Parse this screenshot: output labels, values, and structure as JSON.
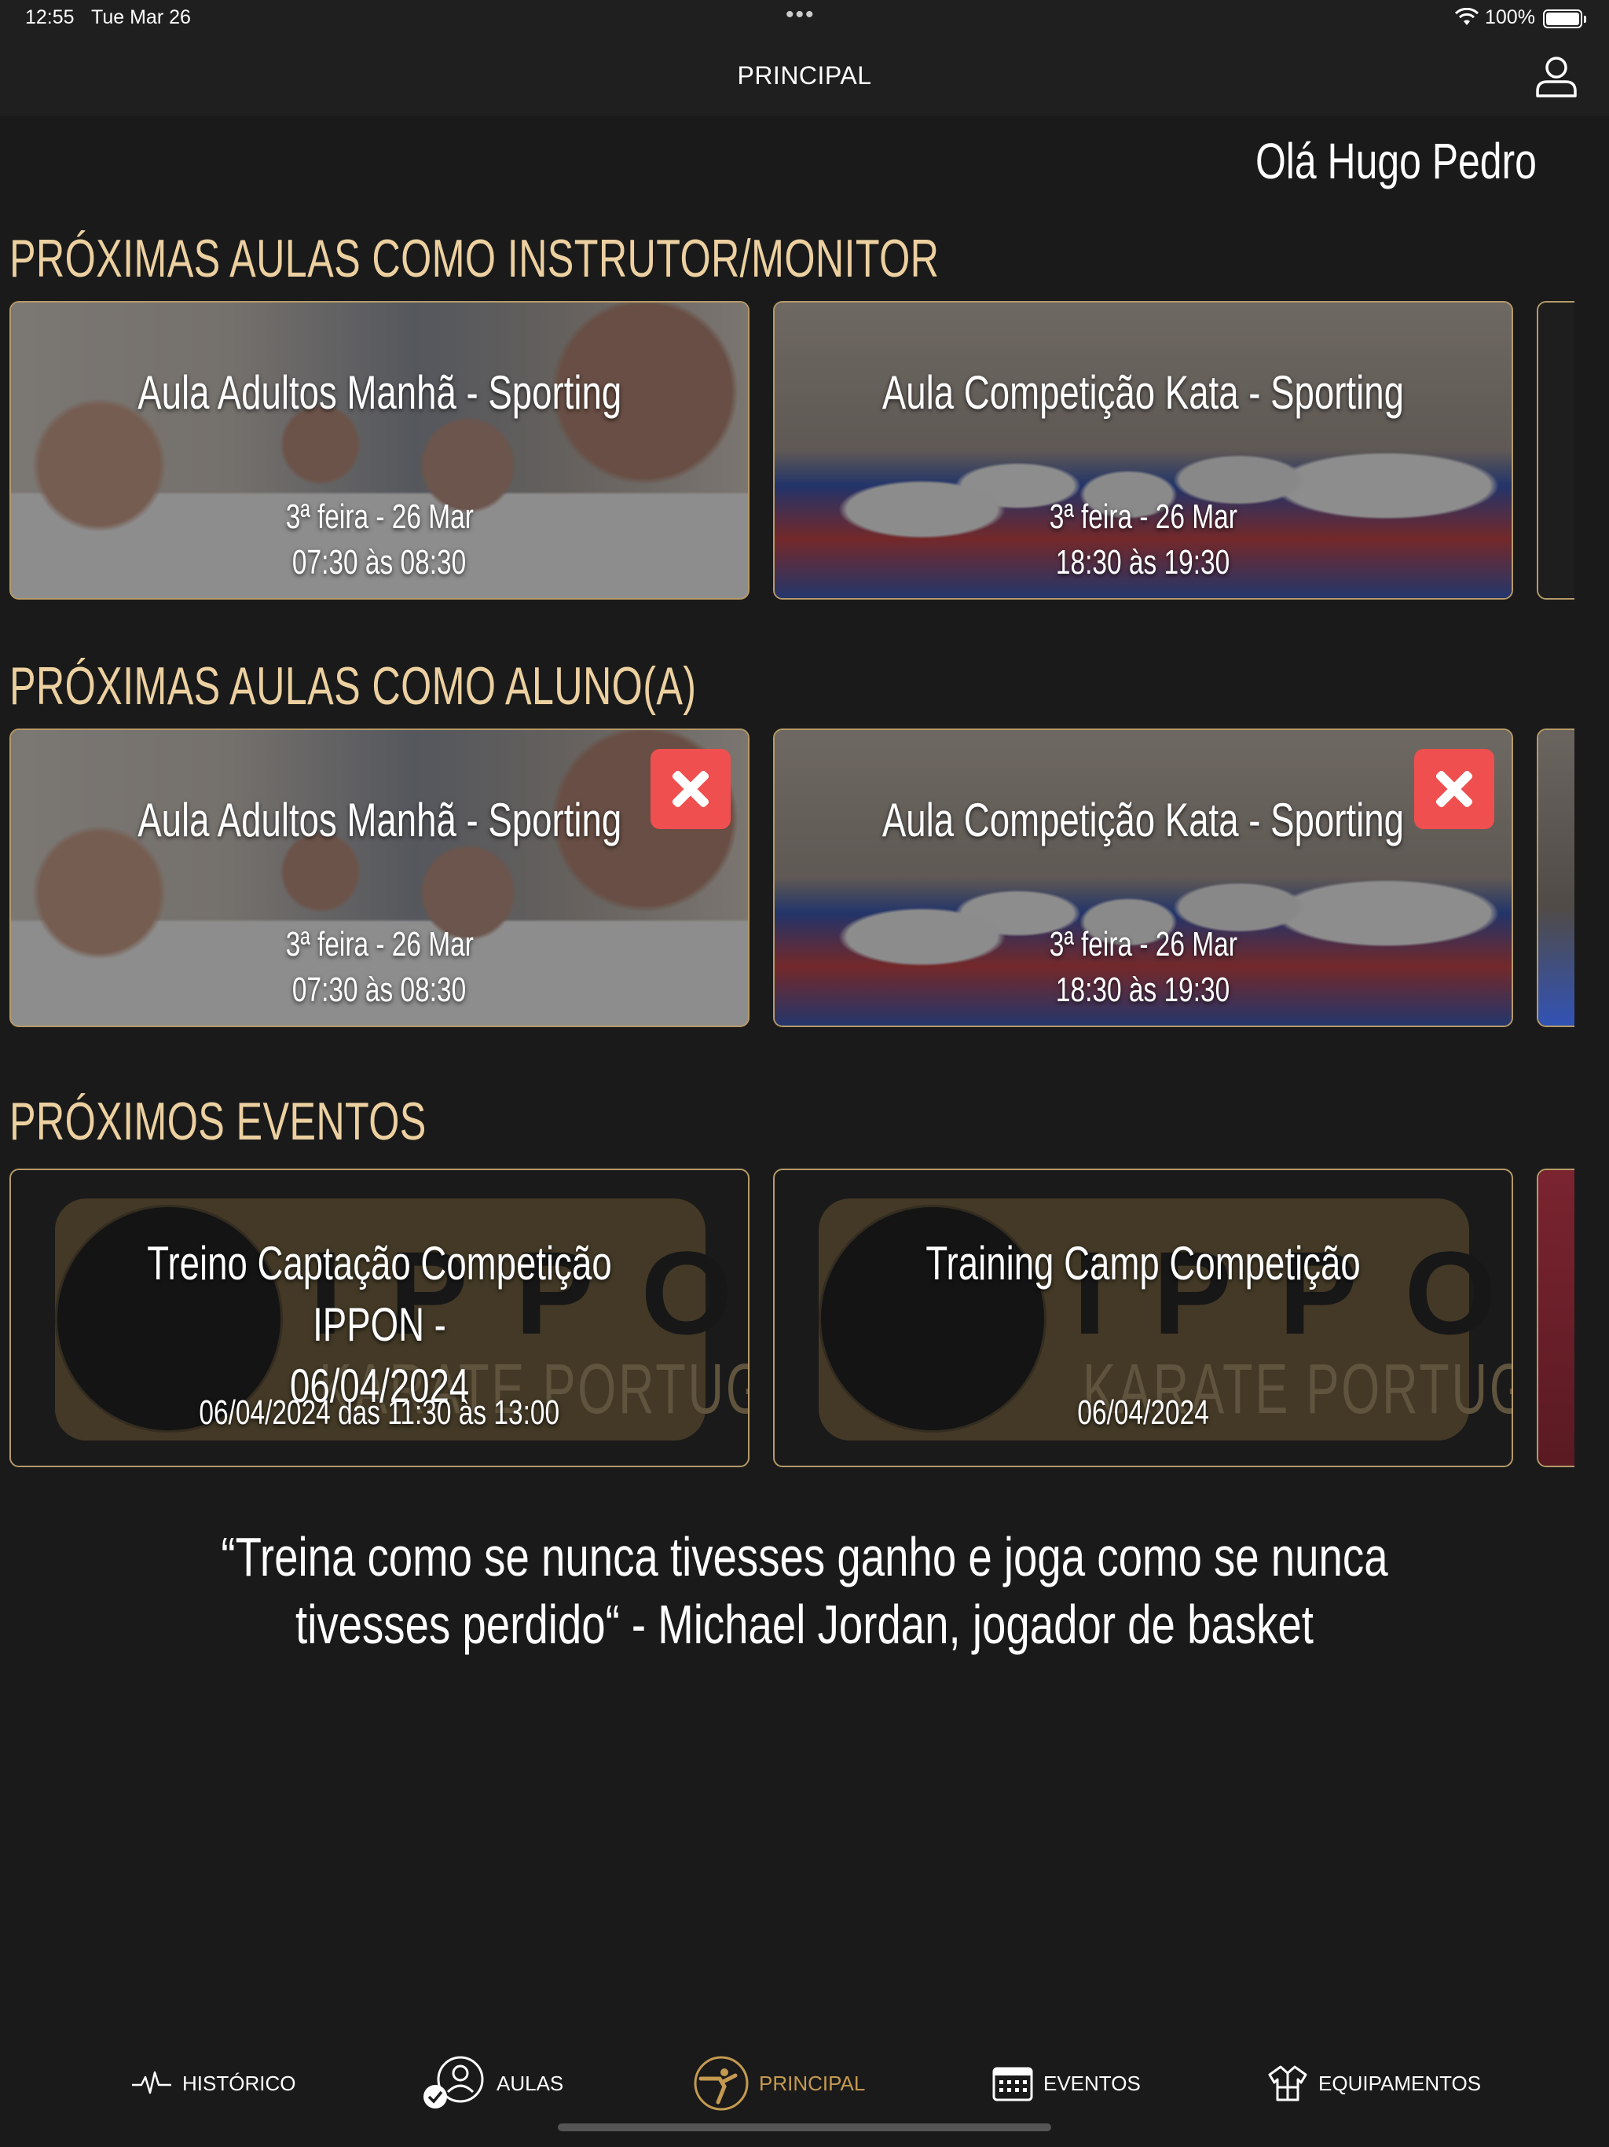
{
  "status_bar": {
    "time": "12:55",
    "date": "Tue Mar 26",
    "battery": "100%"
  },
  "nav": {
    "title": "PRINCIPAL"
  },
  "greeting": "Olá Hugo Pedro",
  "sections": {
    "instructor_title": "PRÓXIMAS AULAS COMO INSTRUTOR/MONITOR",
    "student_title": "PRÓXIMAS AULAS COMO ALUNO(A)",
    "events_title": "PRÓXIMOS EVENTOS"
  },
  "instructor_classes": [
    {
      "title": "Aula Adultos Manhã - Sporting",
      "day": "3ª feira - 26 Mar",
      "time": "07:30 às 08:30"
    },
    {
      "title": "Aula Competição Kata - Sporting",
      "day": "3ª feira - 26 Mar",
      "time": "18:30 às 19:30"
    }
  ],
  "student_classes": [
    {
      "title": "Aula Adultos Manhã - Sporting",
      "day": "3ª feira - 26 Mar",
      "time": "07:30 às 08:30"
    },
    {
      "title": "Aula Competição Kata - Sporting",
      "day": "3ª feira - 26 Mar",
      "time": "18:30 às 19:30"
    }
  ],
  "events": [
    {
      "title_line1": "Treino Captação Competição IPPON -",
      "title_line2": "06/04/2024",
      "date": "06/04/2024 das 11:30 às 13:00",
      "logo_main": "IPPON",
      "logo_sub": "KARATE PORTUGAL"
    },
    {
      "title_line1": "Training Camp Competição",
      "title_line2": "",
      "date": "06/04/2024",
      "logo_main": "IPPON",
      "logo_sub": "KARATE PORTUGAL"
    }
  ],
  "quote": "“Treina como se nunca tivesses ganho e joga como se nunca tivesses perdido“ - Michael Jordan, jogador de basket",
  "tabs": [
    {
      "label": "HISTÓRICO",
      "icon": "heartbeat-icon"
    },
    {
      "label": "AULAS",
      "icon": "user-check-icon"
    },
    {
      "label": "PRINCIPAL",
      "icon": "karate-kick-icon",
      "active": true
    },
    {
      "label": "EVENTOS",
      "icon": "calendar-icon"
    },
    {
      "label": "EQUIPAMENTOS",
      "icon": "gi-icon"
    }
  ],
  "colors": {
    "accent": "#ecd0a0",
    "active_tab": "#c49a50",
    "cancel": "#ef4f4f",
    "card_border": "#b59a69"
  }
}
